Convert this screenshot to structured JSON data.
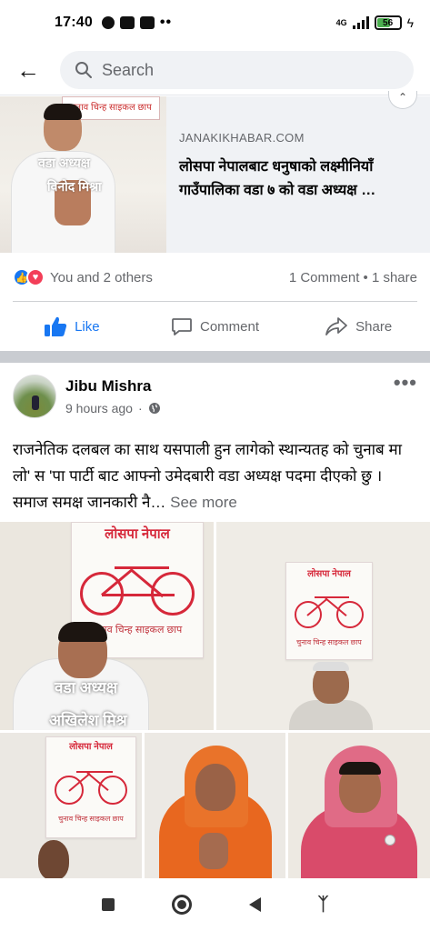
{
  "status_bar": {
    "time": "17:40",
    "network": "4G",
    "battery": "56"
  },
  "search": {
    "placeholder": "Search"
  },
  "link_preview": {
    "domain": "JANAKIKHABAR.COM",
    "title": "लोसपा नेपालबाट धनुषाको लक्ष्मीनियाँ गाउँपालिका वडा ७ को वडा अध्यक्ष …",
    "thumb_caption_1": "वडा अध्यक्ष",
    "thumb_caption_2": "विनोद मिश्रा",
    "thumb_poster": "चुनाव चिन्ह साइकल छाप"
  },
  "reactions": {
    "summary": "You and 2 others",
    "counts": "1 Comment • 1 share"
  },
  "actions": {
    "like": "Like",
    "comment": "Comment",
    "share": "Share"
  },
  "post": {
    "author": "Jibu Mishra",
    "time": "9 hours ago",
    "text": "राजनेतिक  दलबल का साथ यसपाली हुन लागेको स्थान्यतह को चुनाब मा  लो' स 'पा  पार्टी बाट आफ्नो उमेदबारी वडा अध्यक्ष पदमा  दीएको छु । समाज समक्ष जानकारी नै…",
    "see_more": "See more"
  },
  "photos": {
    "poster_title": "लोसपा नेपाल",
    "poster_sub": "चुनाव चिन्ह साइकल छाप",
    "overlay_1": "वडा अध्यक्ष",
    "overlay_2": "अखिलेश मिश्र"
  },
  "colors": {
    "accent": "#1877f2",
    "love": "#f33e58",
    "poster_red": "#d6283a"
  }
}
